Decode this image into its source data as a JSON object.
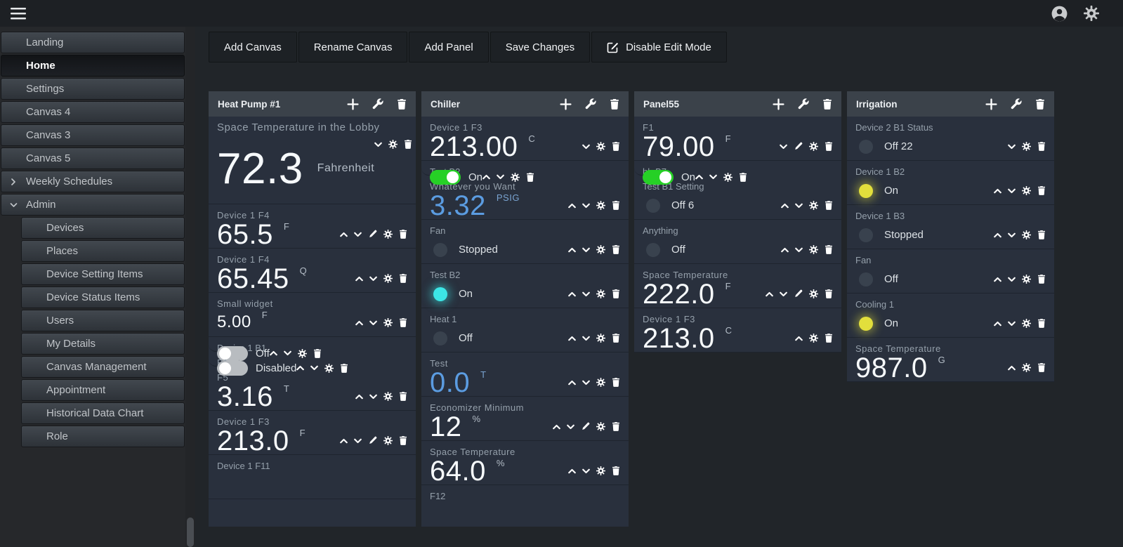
{
  "topbar": {
    "icons": [
      "menu-icon",
      "user-icon",
      "settings-icon"
    ]
  },
  "sidebar": {
    "items": [
      {
        "label": "Landing"
      },
      {
        "label": "Home",
        "active": true
      },
      {
        "label": "Settings"
      },
      {
        "label": "Canvas 4"
      },
      {
        "label": "Canvas 3"
      },
      {
        "label": "Canvas 5"
      },
      {
        "label": "Weekly Schedules",
        "expandable": "collapsed"
      },
      {
        "label": "Admin",
        "expandable": "expanded"
      },
      {
        "label": "Devices",
        "indent": true
      },
      {
        "label": "Places",
        "indent": true
      },
      {
        "label": "Device Setting Items",
        "indent": true
      },
      {
        "label": "Device Status Items",
        "indent": true
      },
      {
        "label": "Users",
        "indent": true
      },
      {
        "label": "My Details",
        "indent": true
      },
      {
        "label": "Canvas Management",
        "indent": true
      },
      {
        "label": "Appointment",
        "indent": true
      },
      {
        "label": "Historical Data Chart",
        "indent": true
      },
      {
        "label": "Role",
        "indent": true
      }
    ]
  },
  "toolbar": {
    "buttons": [
      {
        "label": "Add Canvas"
      },
      {
        "label": "Rename Canvas"
      },
      {
        "label": "Add Panel"
      },
      {
        "label": "Save Changes"
      },
      {
        "label": "Disable Edit Mode",
        "icon": "edit-square"
      }
    ]
  },
  "colors": {
    "toggle_on": "#26d026",
    "toggle_off": "#b8bcc0",
    "status_off": "#39424e",
    "status_cyan": "#3ce6e6",
    "status_yellow": "#e2df3c",
    "value_blue": "#5b9ce1",
    "unit_blue": "#7aa4d2"
  },
  "panels": [
    {
      "title": "Heat Pump #1",
      "scroll_cut": true,
      "widgets": [
        {
          "type": "value",
          "size": "huge",
          "label": "Space Temperature in the Lobby",
          "value": "72.3",
          "unit": "Fahrenheit",
          "controls": [
            "down",
            "settings",
            "delete"
          ]
        },
        {
          "type": "value",
          "label": "Device 1 F4",
          "value": "65.5",
          "unit": "F",
          "controls": [
            "up",
            "down",
            "edit",
            "settings",
            "delete"
          ]
        },
        {
          "type": "value",
          "label": "Device 1 F4",
          "value": "65.45",
          "unit": "Q",
          "controls": [
            "up",
            "down",
            "settings",
            "delete"
          ]
        },
        {
          "type": "value",
          "size": "small-size",
          "label": "Small widget",
          "value": "5.00",
          "unit": "F",
          "controls": [
            "up",
            "down",
            "settings",
            "delete"
          ]
        },
        {
          "type": "toggle",
          "label": "Device 1 B1",
          "state": "off",
          "state_label": "Off",
          "controls": [
            "up",
            "down",
            "settings",
            "delete"
          ]
        },
        {
          "type": "toggle",
          "label": "B1",
          "state": "off",
          "state_label": "Disabled",
          "controls": [
            "up",
            "down",
            "settings",
            "delete"
          ]
        },
        {
          "type": "value",
          "label": "F5",
          "value": "3.16",
          "unit": "T",
          "controls": [
            "up",
            "down",
            "settings",
            "delete"
          ]
        },
        {
          "type": "value",
          "label": "Device 1 F3",
          "value": "213.0",
          "unit": "F",
          "controls": [
            "up",
            "down",
            "edit",
            "settings",
            "delete"
          ]
        },
        {
          "type": "partial",
          "label": "Device 1 F11"
        }
      ]
    },
    {
      "title": "Chiller",
      "scroll_cut": true,
      "widgets": [
        {
          "type": "value",
          "label": "Device 1 F3",
          "value": "213.00",
          "unit": "C",
          "controls": [
            "down",
            "settings",
            "delete"
          ]
        },
        {
          "type": "toggle",
          "label": "Test B2",
          "state": "on",
          "state_label": "On",
          "controls": [
            "up",
            "down",
            "settings",
            "delete"
          ]
        },
        {
          "type": "value",
          "label": "Whatever you Want",
          "value": "3.32",
          "unit": "PSIG",
          "color": "blue",
          "controls": [
            "up",
            "down",
            "settings",
            "delete"
          ]
        },
        {
          "type": "status",
          "label": "Fan",
          "status_color": "off",
          "state_label": "Stopped",
          "controls": [
            "up",
            "down",
            "settings",
            "delete"
          ]
        },
        {
          "type": "status",
          "label": "Test B2",
          "status_color": "cyan",
          "state_label": "On",
          "controls": [
            "up",
            "down",
            "settings",
            "delete"
          ]
        },
        {
          "type": "status",
          "label": "Heat 1",
          "status_color": "off",
          "state_label": "Off",
          "controls": [
            "up",
            "down",
            "settings",
            "delete"
          ]
        },
        {
          "type": "value",
          "label": "Test",
          "value": "0.0",
          "unit": "T",
          "color": "blue",
          "controls": [
            "up",
            "down",
            "settings",
            "delete"
          ]
        },
        {
          "type": "value",
          "label": "Economizer Minimum",
          "value": "12",
          "unit": "%",
          "controls": [
            "up",
            "down",
            "edit",
            "settings",
            "delete"
          ]
        },
        {
          "type": "value",
          "label": "Space Temperature",
          "value": "64.0",
          "unit": "%",
          "controls": [
            "up",
            "down",
            "settings",
            "delete"
          ]
        },
        {
          "type": "partial",
          "label": "F12"
        }
      ]
    },
    {
      "title": "Panel55",
      "widgets": [
        {
          "type": "value",
          "label": "F1",
          "value": "79.00",
          "unit": "F",
          "controls": [
            "down",
            "edit",
            "settings",
            "delete"
          ]
        },
        {
          "type": "toggle",
          "label": "hb B7",
          "state": "on",
          "state_label": "On",
          "controls": [
            "up",
            "down",
            "settings",
            "delete"
          ]
        },
        {
          "type": "status",
          "label": "Test B1 Setting",
          "status_color": "off",
          "state_label": "Off 6",
          "controls": [
            "up",
            "down",
            "settings",
            "delete"
          ]
        },
        {
          "type": "status",
          "label": "Anything",
          "status_color": "off",
          "state_label": "Off",
          "controls": [
            "up",
            "down",
            "settings",
            "delete"
          ]
        },
        {
          "type": "value",
          "label": "Space Temperature",
          "value": "222.0",
          "unit": "F",
          "controls": [
            "up",
            "down",
            "edit",
            "settings",
            "delete"
          ]
        },
        {
          "type": "value",
          "label": "Device 1 F3",
          "value": "213.0",
          "unit": "C",
          "controls": [
            "up",
            "settings",
            "delete"
          ]
        }
      ]
    },
    {
      "title": "Irrigation",
      "widgets": [
        {
          "type": "status",
          "label": "Device 2 B1 Status",
          "status_color": "off",
          "state_label": "Off 22",
          "controls": [
            "down",
            "settings",
            "delete"
          ]
        },
        {
          "type": "status",
          "label": "Device 1 B2",
          "status_color": "yellow",
          "state_label": "On",
          "controls": [
            "up",
            "down",
            "settings",
            "delete"
          ]
        },
        {
          "type": "status",
          "label": "Device 1 B3",
          "status_color": "off",
          "state_label": "Stopped",
          "controls": [
            "up",
            "down",
            "settings",
            "delete"
          ]
        },
        {
          "type": "status",
          "label": "Fan",
          "status_color": "off",
          "state_label": "Off",
          "controls": [
            "up",
            "down",
            "settings",
            "delete"
          ]
        },
        {
          "type": "status",
          "label": "Cooling 1",
          "status_color": "yellow",
          "state_label": "On",
          "controls": [
            "up",
            "down",
            "settings",
            "delete"
          ]
        },
        {
          "type": "value",
          "label": "Space Temperature",
          "value": "987.0",
          "unit": "G",
          "controls": [
            "up",
            "settings",
            "delete"
          ]
        }
      ]
    }
  ]
}
